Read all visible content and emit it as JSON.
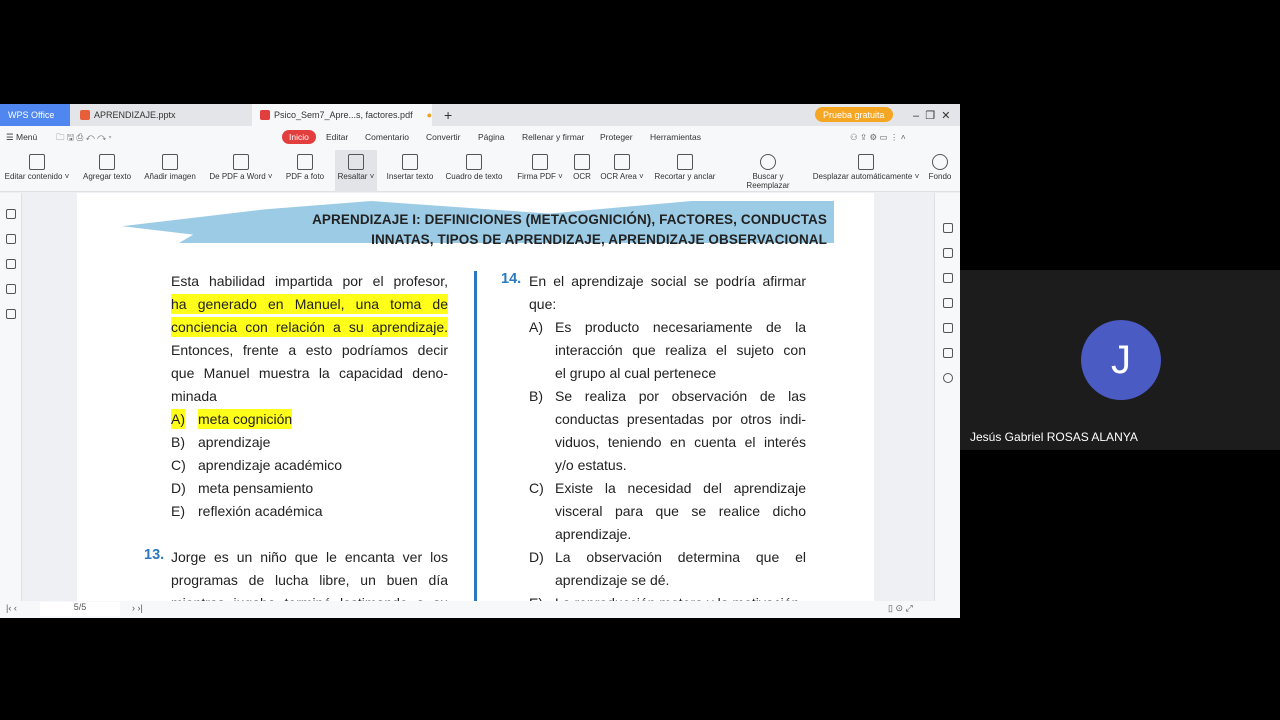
{
  "tabs": {
    "wps": "WPS Office",
    "t1": "APRENDIZAJE.pptx",
    "t2": "Psico_Sem7_Apre...s, factores.pdf",
    "trial": "Prueba gratuita"
  },
  "menu": {
    "menu": "Menú",
    "items": [
      "Inicio",
      "Editar",
      "Comentario",
      "Convertir",
      "Página",
      "Rellenar y firmar",
      "Proteger",
      "Herramientas"
    ]
  },
  "toolbar": [
    "Editar contenido ˅",
    "Agregar texto",
    "Añadir imagen",
    "De PDF a Word ˅",
    "PDF a foto",
    "Resaltar ˅",
    "Insertar texto",
    "Cuadro de texto",
    "Firma PDF ˅",
    "OCR",
    "OCR Area ˅",
    "Recortar y anclar",
    "Buscar y Reemplazar",
    "Desplazar automáticamente ˅",
    "Fondo"
  ],
  "doc": {
    "title1": "APRENDIZAJE I: DEFINICIONES (METACOGNICIÓN), FACTORES, CONDUCTAS",
    "title2": "INNATAS, TIPOS DE APRENDIZAJE, APRENDIZAJE OBSERVACIONAL",
    "left": [
      "Esta habilidad impartida por el profesor,",
      "ha generado en Manuel, una toma de",
      "conciencia con relación a su aprendizaje.",
      "Entonces, frente a esto podríamos decir",
      "que Manuel muestra la capacidad deno-",
      "minada"
    ],
    "opts12": [
      [
        "A)",
        "meta cognición"
      ],
      [
        "B)",
        "aprendizaje"
      ],
      [
        "C)",
        "aprendizaje académico"
      ],
      [
        "D)",
        "meta pensamiento"
      ],
      [
        "E)",
        "reflexión académica"
      ]
    ],
    "q13n": "13.",
    "q13": [
      "Jorge es un niño que le encanta ver los",
      "programas de lucha libre, un buen día",
      "mientras jugaba terminó lastimando a su"
    ],
    "q14n": "14.",
    "q14": [
      "En el aprendizaje social se podría afirmar",
      "que:"
    ],
    "opts14": [
      {
        "l": "A)",
        "lines": [
          "Es producto necesariamente de la",
          "interacción que realiza el sujeto con",
          "el grupo al cual pertenece"
        ]
      },
      {
        "l": "B)",
        "lines": [
          "Se realiza por observación de las",
          "conductas presentadas por otros indi-",
          "viduos, teniendo en cuenta el interés",
          "y/o estatus."
        ]
      },
      {
        "l": "C)",
        "lines": [
          "Existe la necesidad del aprendizaje",
          "visceral para que se realice dicho",
          "aprendizaje."
        ]
      },
      {
        "l": "D)",
        "lines": [
          "La observación determina que el",
          "aprendizaje se dé."
        ]
      },
      {
        "l": "E)",
        "lines": [
          "La reproducción motora y la motivación"
        ]
      }
    ]
  },
  "status": {
    "page": "5/5"
  },
  "participant": {
    "initial": "J",
    "name": "Jesús Gabriel ROSAS ALANYA"
  }
}
